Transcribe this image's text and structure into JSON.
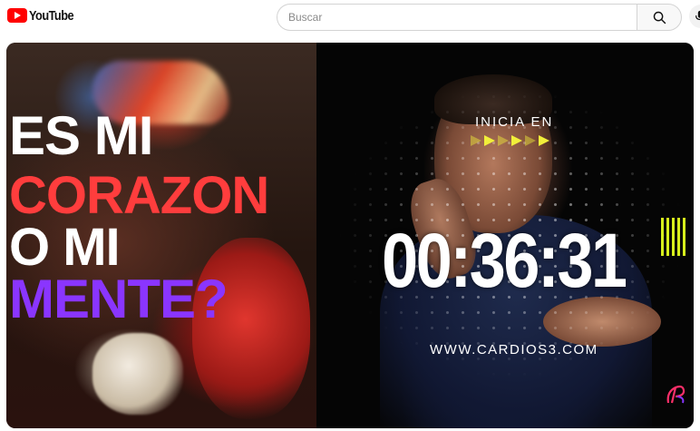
{
  "header": {
    "logo_text": "YouTube",
    "search_placeholder": "Buscar",
    "search_icon": "search-icon",
    "mic_icon": "microphone-icon"
  },
  "video": {
    "thumbnail_title_lines": [
      "ES MI",
      "CORAZON",
      "O MI",
      "MENTE?"
    ],
    "title_colors": [
      "#ffffff",
      "#ff3d3d",
      "#ffffff",
      "#8a35ff"
    ],
    "countdown_label": "INICIA EN",
    "countdown": "00:36:31",
    "website": "WWW.CARDIOS3.COM",
    "accent_color": "#f1ef3a",
    "brand_icon": "cardios-logo-icon"
  }
}
